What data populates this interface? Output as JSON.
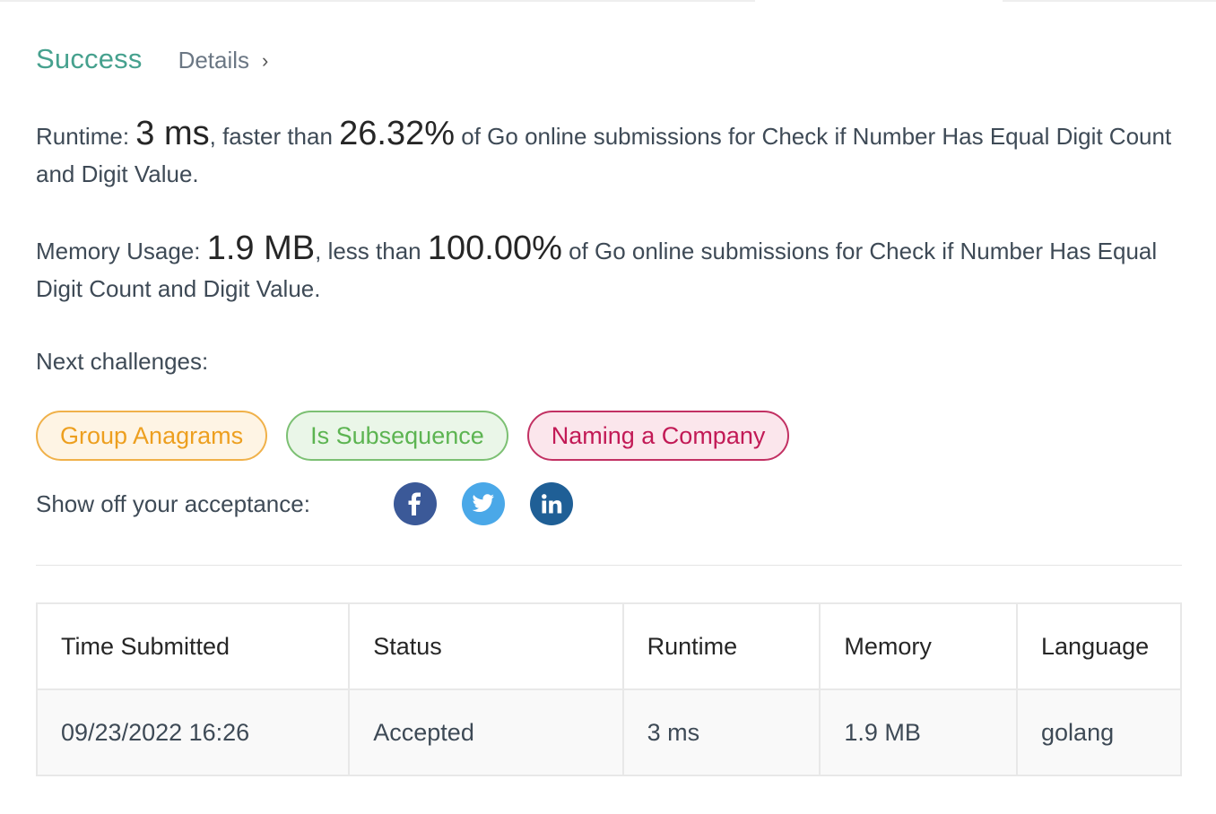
{
  "header": {
    "status": "Success",
    "details_label": "Details",
    "details_chevron": "›"
  },
  "runtime": {
    "label": "Runtime: ",
    "value": "3 ms",
    "comparison": ", faster than ",
    "percent": "26.32%",
    "suffix": " of Go online submissions for Check if Number Has Equal Digit Count and Digit Value."
  },
  "memory": {
    "label": "Memory Usage: ",
    "value": "1.9 MB",
    "comparison": ", less than ",
    "percent": "100.00%",
    "suffix": " of Go online submissions for Check if Number Has Equal Digit Count and Digit Value."
  },
  "next_challenges": {
    "label": "Next challenges:",
    "items": [
      {
        "label": "Group Anagrams",
        "color": "#ed9f1f"
      },
      {
        "label": "Is Subsequence",
        "color": "#5cb451"
      },
      {
        "label": "Naming a Company",
        "color": "#c21a56"
      }
    ]
  },
  "share": {
    "label": "Show off your acceptance:",
    "icons": [
      "facebook-icon",
      "twitter-icon",
      "linkedin-icon"
    ]
  },
  "table": {
    "headers": [
      "Time Submitted",
      "Status",
      "Runtime",
      "Memory",
      "Language"
    ],
    "rows": [
      {
        "time": "09/23/2022 16:26",
        "status": "Accepted",
        "runtime": "3 ms",
        "memory": "1.9 MB",
        "language": "golang"
      }
    ]
  },
  "colors": {
    "success": "#46a18e",
    "facebook": "#3b5998",
    "twitter": "#4aa8e8",
    "linkedin": "#1f5f96"
  }
}
